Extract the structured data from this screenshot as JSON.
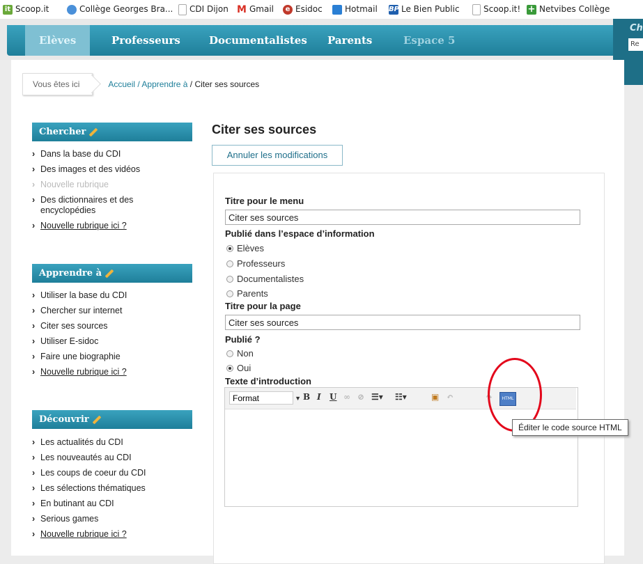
{
  "bookmarks": [
    {
      "label": "Scoop.it",
      "icon": "scoopit-icon",
      "color": "#6aa83a"
    },
    {
      "label": "Collège Georges Bra...",
      "icon": "globe-icon",
      "color": "#4a90d9"
    },
    {
      "label": "CDI Dijon",
      "icon": "page-icon",
      "color": "#999999"
    },
    {
      "label": "Gmail",
      "icon": "gmail-icon",
      "color": "#d93025"
    },
    {
      "label": "Esidoc",
      "icon": "esidoc-icon",
      "color": "#c0392b"
    },
    {
      "label": "Hotmail",
      "icon": "hotmail-icon",
      "color": "#2a7fd4"
    },
    {
      "label": "Le Bien Public",
      "icon": "bp-icon",
      "color": "#1f5fae"
    },
    {
      "label": "Scoop.it!",
      "icon": "page-icon",
      "color": "#999999"
    },
    {
      "label": "Netvibes Collège",
      "icon": "netvibes-icon",
      "color": "#3a9a3a"
    }
  ],
  "nav": {
    "items": [
      "Elèves",
      "Professeurs",
      "Documentalistes",
      "Parents",
      "Espace 5"
    ],
    "corner_title": "Ch",
    "corner_input": "Re"
  },
  "breadcrumb": {
    "here": "Vous êtes ici",
    "home": "Accueil",
    "sep": " / ",
    "section": "Apprendre à",
    "current": "Citer ses sources"
  },
  "sidebar": {
    "chercher": {
      "title": "Chercher",
      "items": [
        "Dans la base du CDI",
        "Des images et des vidéos",
        "Nouvelle rubrique",
        "Des dictionnaires et des encyclopédies",
        "Nouvelle rubrique ici ?"
      ]
    },
    "apprendre": {
      "title": "Apprendre à",
      "items": [
        "Utiliser la base du CDI",
        "Chercher sur internet",
        "Citer ses sources",
        "Utiliser E-sidoc",
        "Faire une biographie",
        "Nouvelle rubrique ici ?"
      ]
    },
    "decouvrir": {
      "title": "Découvrir",
      "items": [
        "Les actualités du CDI",
        "Les nouveautés au CDI",
        "Les coups de coeur du CDI",
        "Les sélections thématiques",
        "En butinant au CDI",
        "Serious games",
        "Nouvelle rubrique ici ?"
      ]
    }
  },
  "main": {
    "title": "Citer ses sources",
    "cancel_label": "Annuler les modifications"
  },
  "form": {
    "menu_title_label": "Titre pour le menu",
    "menu_title_value": "Citer ses sources",
    "published_in_label": "Publié dans l’espace d’information",
    "spaces": [
      {
        "label": "Elèves",
        "checked": true
      },
      {
        "label": "Professeurs",
        "checked": false
      },
      {
        "label": "Documentalistes",
        "checked": false
      },
      {
        "label": "Parents",
        "checked": false
      }
    ],
    "page_title_label": "Titre pour la page",
    "page_title_value": "Citer ses sources",
    "published_label": "Publié ?",
    "published_options": [
      {
        "label": "Non",
        "checked": false
      },
      {
        "label": "Oui",
        "checked": true
      }
    ],
    "intro_label": "Texte d’introduction"
  },
  "editor": {
    "format_label": "Format",
    "html_button_label": "HTML",
    "tooltip": "Éditer le code source HTML"
  },
  "annotation_color": "#e3071b"
}
